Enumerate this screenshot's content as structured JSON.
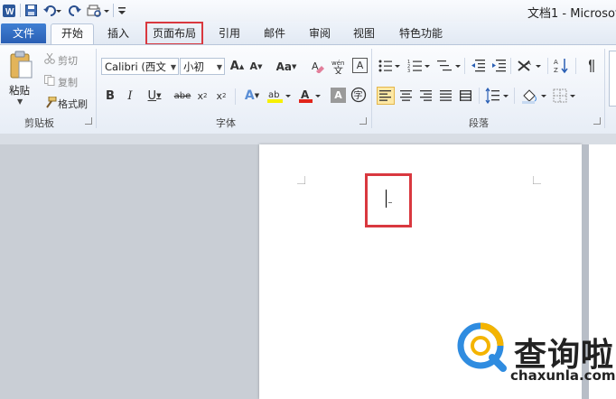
{
  "window": {
    "title": "文档1 - Microsof"
  },
  "quick_access": {
    "save_icon": "save-icon",
    "undo_icon": "undo-icon",
    "redo_icon": "redo-icon"
  },
  "tabs": [
    {
      "label": "文件"
    },
    {
      "label": "开始"
    },
    {
      "label": "插入"
    },
    {
      "label": "页面布局"
    },
    {
      "label": "引用"
    },
    {
      "label": "邮件"
    },
    {
      "label": "审阅"
    },
    {
      "label": "视图"
    },
    {
      "label": "特色功能"
    }
  ],
  "clipboard": {
    "paste_label": "粘贴",
    "cut_label": "剪切",
    "copy_label": "复制",
    "format_painter_label": "格式刷",
    "group_label": "剪贴板"
  },
  "font": {
    "font_name": "Calibri (西文",
    "font_size": "小初",
    "group_label": "字体"
  },
  "paragraph": {
    "group_label": "段落"
  },
  "watermark": {
    "brand": "查询啦",
    "url": "chaxunla.com"
  },
  "colors": {
    "highlight": "#d9383f",
    "file_tab": "#2a5fb4",
    "accent": "#2a5fb4"
  }
}
